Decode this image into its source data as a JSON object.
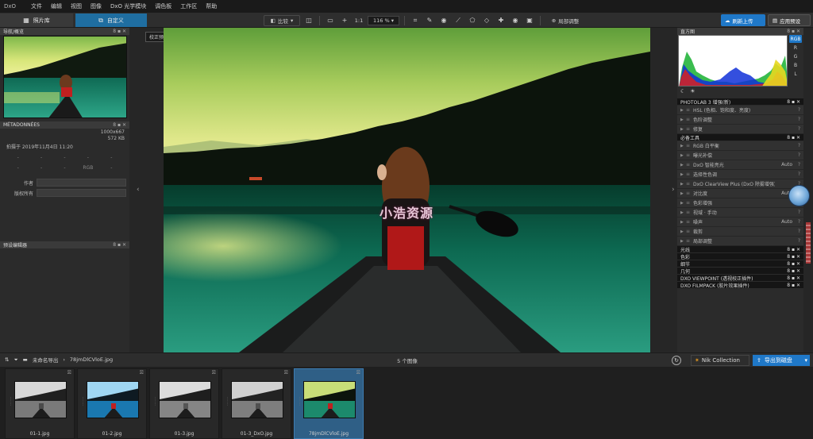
{
  "menubar": {
    "logo": "DxO",
    "items": [
      "文件",
      "编辑",
      "视图",
      "图像",
      "DxO 光学模块",
      "调色板",
      "工作区",
      "帮助"
    ]
  },
  "toolbar": {
    "tab_library": "照片库",
    "tab_custom": "自定义",
    "compare_label": "比较",
    "one_to_one": "1:1",
    "zoom_value": "116 %",
    "local_adjust_label": "局部调整",
    "upload_label": "刷新上传",
    "preset_label": "应用预设"
  },
  "left_panel": {
    "nav_title": "导航/概览",
    "meta_title": "MÉTADONNÉES",
    "image_size": "1000x667",
    "file_size": "572 KB",
    "shot_date": "拍摄于 2019年11月4日 11:20",
    "exif": [
      "-",
      "-",
      "-",
      "-",
      "-",
      "-",
      "-",
      "-",
      "RGB",
      "-"
    ],
    "author_label": "作者",
    "copyright_label": "版权所有",
    "preset_editor_title": "预设编辑器"
  },
  "center": {
    "tooltip": "校正预览",
    "watermark": "小浩资源"
  },
  "histogram": {
    "title": "直方图",
    "channels": [
      "RGB",
      "R",
      "G",
      "B",
      "L"
    ],
    "colors": {
      "red": "#d82020",
      "green": "#18b030",
      "blue": "#1030d8",
      "yellow": "#e8d820"
    }
  },
  "tool_groups": [
    {
      "title": "PHOTOLAB 3 增强(新)",
      "items": [
        {
          "name": "HSL (色相、饱和度、亮度)",
          "value": ""
        },
        {
          "name": "色阶调整",
          "value": ""
        },
        {
          "name": "修复",
          "value": ""
        }
      ]
    },
    {
      "title": "必备工具",
      "items": [
        {
          "name": "RGB 白平衡",
          "value": ""
        },
        {
          "name": "曝光补偿",
          "value": ""
        },
        {
          "name": "DxO 智能亮光",
          "value": "Auto"
        },
        {
          "name": "选择性色调",
          "value": ""
        },
        {
          "name": "DxO ClearView Plus (DxO 除雾增强)",
          "value": ""
        },
        {
          "name": "对比度",
          "value": "Auto"
        },
        {
          "name": "色彩增强",
          "value": ""
        },
        {
          "name": "视域 · 手动",
          "value": ""
        },
        {
          "name": "噪声",
          "value": "Auto"
        },
        {
          "name": "裁剪",
          "value": ""
        },
        {
          "name": "局部调整",
          "value": ""
        }
      ]
    }
  ],
  "collapsed_groups": [
    "光线",
    "色彩",
    "细节",
    "几何",
    "DXO VIEWPOINT (透视校正插件)",
    "DXO FILMPACK (胶片效果插件)"
  ],
  "bottombar": {
    "folder": "未命名导出",
    "filename": "78jmDlCVloE.jpg",
    "count": "5 个图像",
    "nik_label": "Nik Collection",
    "export_label": "导出到磁盘"
  },
  "filmstrip": [
    {
      "name": "01-1.jpg",
      "style": "bw"
    },
    {
      "name": "01-2.jpg",
      "style": "blue"
    },
    {
      "name": "01-3.jpg",
      "style": "bw"
    },
    {
      "name": "01-3_DxO.jpg",
      "style": "bw"
    },
    {
      "name": "78jmDlCVloE.jpg",
      "style": "green"
    }
  ]
}
